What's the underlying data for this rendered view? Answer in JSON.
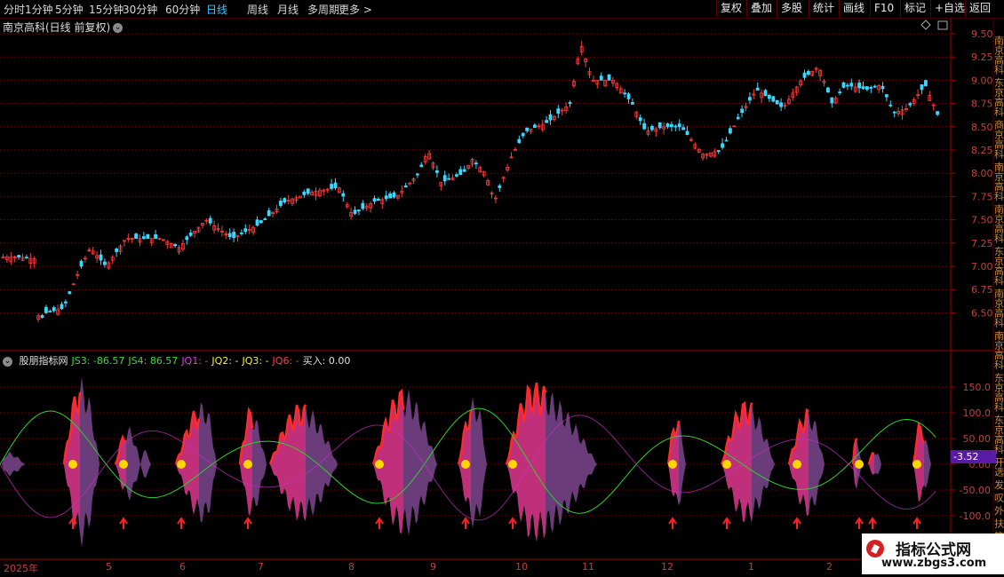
{
  "toolbar": {
    "periods": [
      "分时",
      "1分钟",
      "5分钟",
      "15分钟",
      "30分钟",
      "60分钟",
      "日线",
      "周线",
      "月线",
      "多周期",
      "更多 >"
    ],
    "active_period": "日线",
    "right_buttons": [
      "复权",
      "叠加",
      "多股",
      "统计",
      "画线",
      "F10",
      "标记",
      "+自选",
      "返回"
    ]
  },
  "main_chart": {
    "title": "南京高科(日线 前复权)",
    "yticks": [
      "9.50",
      "9.25",
      "9.00",
      "8.75",
      "8.50",
      "8.25",
      "8.00",
      "7.75",
      "7.50",
      "7.25",
      "7.00",
      "6.75",
      "6.50"
    ],
    "right_side_text": "南京高科 东京高科 商京高科 南京高科 南京高科 东京高科 南京高科 南京高科 东京高科 东京高科 开选 发 叹 外 扶 等 收"
  },
  "indicator": {
    "name": "股朋指标网",
    "items": [
      {
        "label": "JS3: -86.57",
        "color": "#3cdc3c"
      },
      {
        "label": "JS4: 86.57",
        "color": "#3cdc3c"
      },
      {
        "label": "JQ1: -",
        "color": "#e040e0"
      },
      {
        "label": "JQ2: -",
        "color": "#f0f040"
      },
      {
        "label": "JQ3: -",
        "color": "#f0f040"
      },
      {
        "label": "JQ6: -",
        "color": "#ff4040"
      },
      {
        "label": "买入: 0.00",
        "color": "#e0e0e0"
      }
    ],
    "yticks": [
      "150.0",
      "100.0",
      "50.00",
      "0.00",
      "-50.00",
      "-100.0"
    ],
    "current_value": "-3.52"
  },
  "date_axis": [
    "2025年",
    "5",
    "6",
    "7",
    "8",
    "9",
    "10",
    "11",
    "12",
    "1",
    "2"
  ],
  "watermark": {
    "line1": "指标公式网",
    "line2": "www.zbgs3.com"
  },
  "colors": {
    "up": "#ff3a3a",
    "down": "#3ad8ff",
    "grid": "#7a0000",
    "band": "#6a3c7a",
    "band_hi": "#c0307a",
    "buy_dot": "#ffd700"
  }
}
